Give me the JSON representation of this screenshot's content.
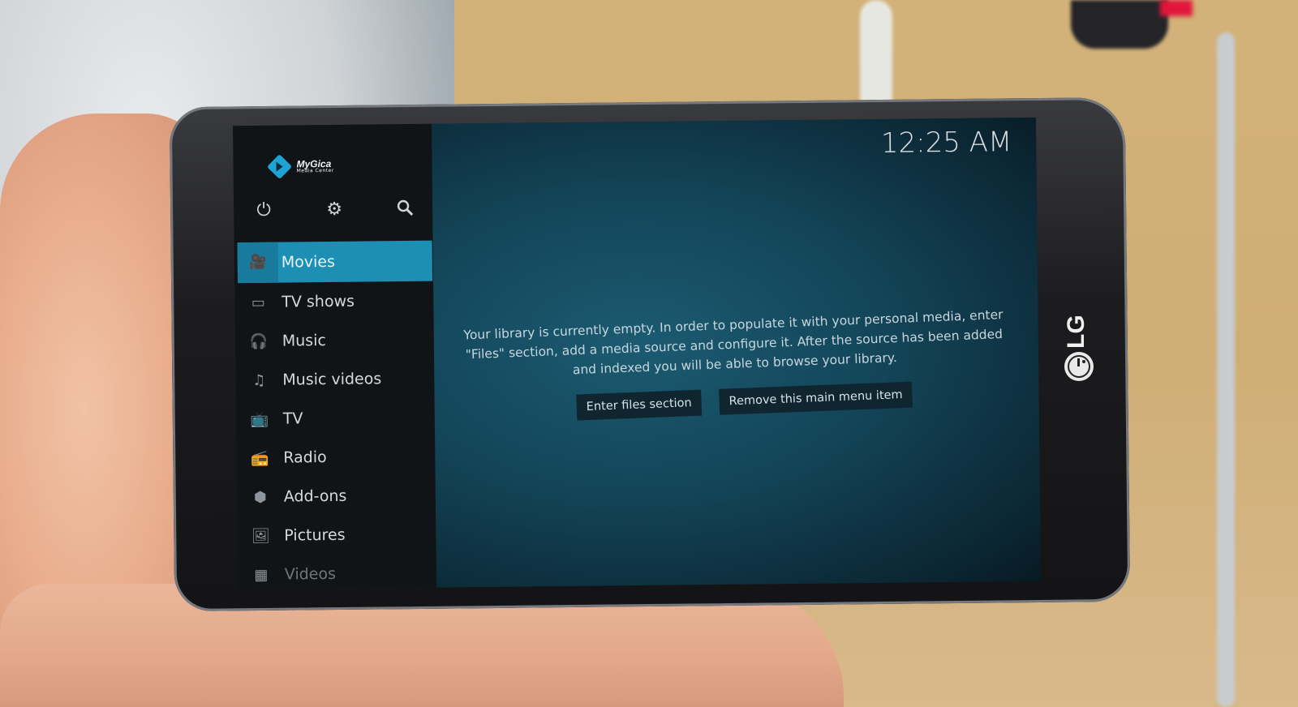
{
  "screen": {
    "brand": {
      "name": "MyGica",
      "subtitle": "Media Center"
    },
    "clock": "12:25 AM",
    "top_icons": [
      "power-icon",
      "gear-icon",
      "search-icon"
    ],
    "menu": [
      {
        "label": "Movies",
        "icon": "movie-camera-icon",
        "active": true
      },
      {
        "label": "TV shows",
        "icon": "monitor-icon"
      },
      {
        "label": "Music",
        "icon": "headphones-icon"
      },
      {
        "label": "Music videos",
        "icon": "music-video-icon"
      },
      {
        "label": "TV",
        "icon": "tv-icon"
      },
      {
        "label": "Radio",
        "icon": "radio-icon"
      },
      {
        "label": "Add-ons",
        "icon": "addons-box-icon"
      },
      {
        "label": "Pictures",
        "icon": "picture-icon"
      },
      {
        "label": "Videos",
        "icon": "film-icon"
      }
    ],
    "message": "Your library is currently empty. In order to populate it with your personal media, enter \"Files\" section, add a media source and configure it. After the source has been added and indexed you will be able to browse your library.",
    "buttons": {
      "enter_files": "Enter files section",
      "remove_item": "Remove this main menu item"
    },
    "accent_color": "#1d8fb5"
  },
  "device": {
    "brand_logo": "LG"
  }
}
